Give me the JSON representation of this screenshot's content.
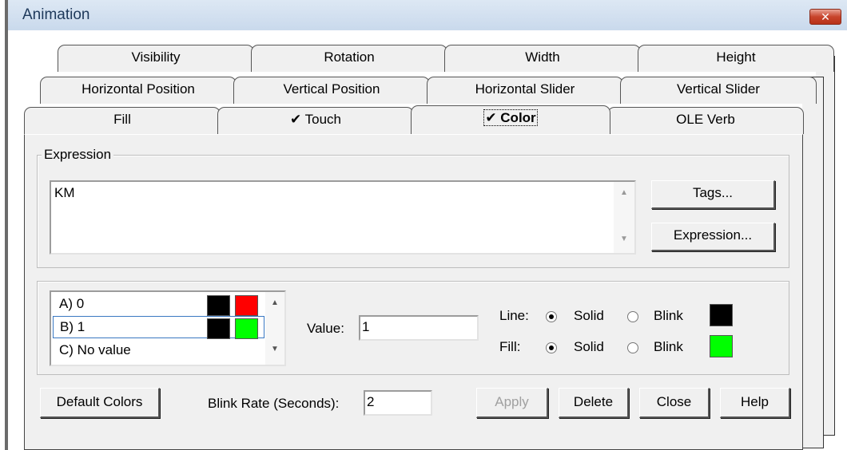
{
  "window": {
    "title": "Animation",
    "close_glyph": "✕"
  },
  "tabs": {
    "row1": [
      "Visibility",
      "Rotation",
      "Width",
      "Height"
    ],
    "row2": [
      "Horizontal Position",
      "Vertical Position",
      "Horizontal Slider",
      "Vertical Slider"
    ],
    "row3": [
      "Fill",
      "✔ Touch",
      "✔ Color",
      "OLE Verb"
    ],
    "active": "✔ Color"
  },
  "expression": {
    "group_label": "Expression",
    "value": "KM",
    "tags_button": "Tags...",
    "expression_button": "Expression..."
  },
  "colors_list": {
    "items": [
      {
        "label": "A) 0",
        "line_color": "#000000",
        "fill_color": "#ff0000"
      },
      {
        "label": "B) 1",
        "line_color": "#000000",
        "fill_color": "#00ff00",
        "selected": true
      },
      {
        "label": "C) No value"
      }
    ]
  },
  "value_field": {
    "label": "Value:",
    "value": "1"
  },
  "line": {
    "label": "Line:",
    "solid_label": "Solid",
    "blink_label": "Blink",
    "selected": "Solid",
    "color": "#000000"
  },
  "fill": {
    "label": "Fill:",
    "solid_label": "Solid",
    "blink_label": "Blink",
    "selected": "Solid",
    "color": "#00ff00"
  },
  "bottom": {
    "default_colors_button": "Default Colors",
    "blink_rate_label": "Blink Rate (Seconds):",
    "blink_rate_value": "2",
    "apply_button": "Apply",
    "delete_button": "Delete",
    "close_button": "Close",
    "help_button": "Help"
  },
  "icons": {
    "scroll_up": "▲",
    "scroll_down": "▼"
  }
}
